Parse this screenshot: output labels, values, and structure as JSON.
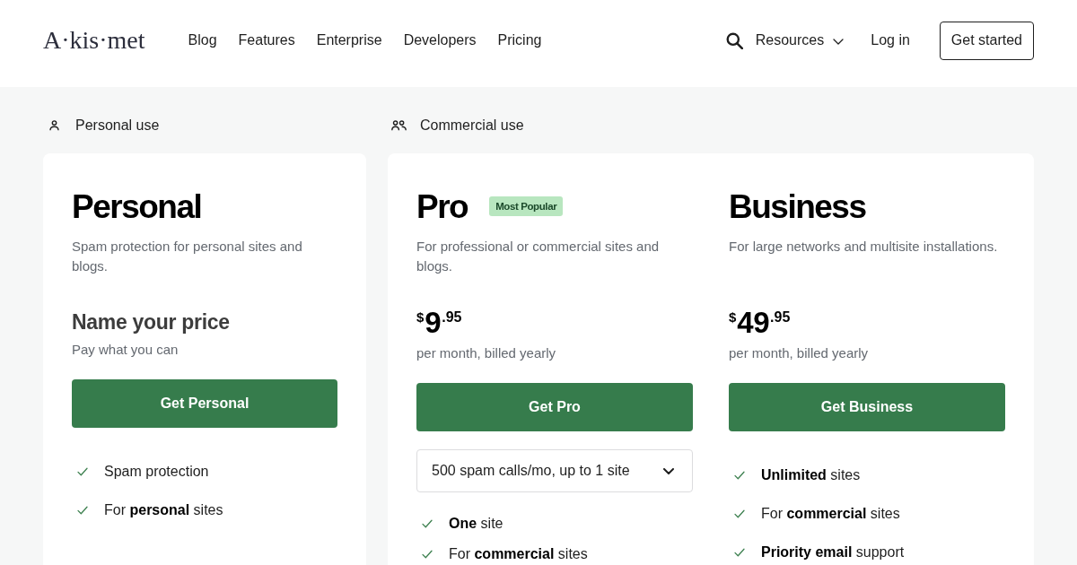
{
  "header": {
    "logo": "A·kis·met",
    "nav": [
      "Blog",
      "Features",
      "Enterprise",
      "Developers",
      "Pricing"
    ],
    "resources": "Resources",
    "login": "Log in",
    "cta": "Get started"
  },
  "sections": [
    {
      "kind": "personal",
      "label": "Personal use",
      "plans": [
        {
          "name": "Personal",
          "description": "Spam protection for personal sites and blogs.",
          "price": {
            "kind": "custom",
            "heading": "Name your price",
            "note": "Pay what you can"
          },
          "button": "Get Personal",
          "features": [
            "Spam protection",
            "For **personal** sites"
          ]
        }
      ]
    },
    {
      "kind": "commercial",
      "label": "Commercial use",
      "plans": [
        {
          "name": "Pro",
          "badge": "Most Popular",
          "description": "For professional or commercial sites and blogs.",
          "price": {
            "kind": "amount",
            "currency": "$",
            "whole": "9",
            "fraction": ".95",
            "note": "per month, billed yearly"
          },
          "button": "Get Pro",
          "tier_select": {
            "value": "500 spam calls/mo, up to 1 site"
          },
          "features": [
            "**One** site",
            "For **commercial** sites"
          ]
        },
        {
          "name": "Business",
          "description": "For large networks and multisite installations.",
          "price": {
            "kind": "amount",
            "currency": "$",
            "whole": "49",
            "fraction": ".95",
            "note": "per month, billed yearly"
          },
          "button": "Get Business",
          "features": [
            "**Unlimited** sites",
            "For **commercial** sites",
            "**Priority email** support"
          ]
        }
      ]
    }
  ]
}
